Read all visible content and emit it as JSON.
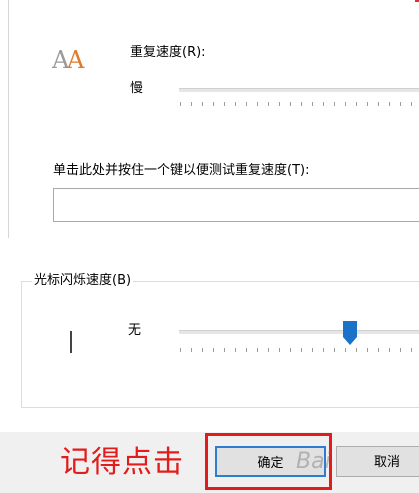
{
  "repeat": {
    "icon": "repeat-delay-aa-icon",
    "speed_label": "重复速度(R):",
    "slow_label": "慢",
    "test_label": "单击此处并按住一个键以便测试重复速度(T):",
    "test_value": ""
  },
  "cursor": {
    "group_title": "光标闪烁速度(B)",
    "none_label": "无",
    "icon": "text-cursor-icon",
    "thumb_color": "#1a73c8"
  },
  "buttons": {
    "ok_label": "确定",
    "cancel_label": "取消"
  },
  "annotation": {
    "text": "记得点击",
    "color": "#e21b1b"
  },
  "watermark": {
    "text": "Bai"
  }
}
